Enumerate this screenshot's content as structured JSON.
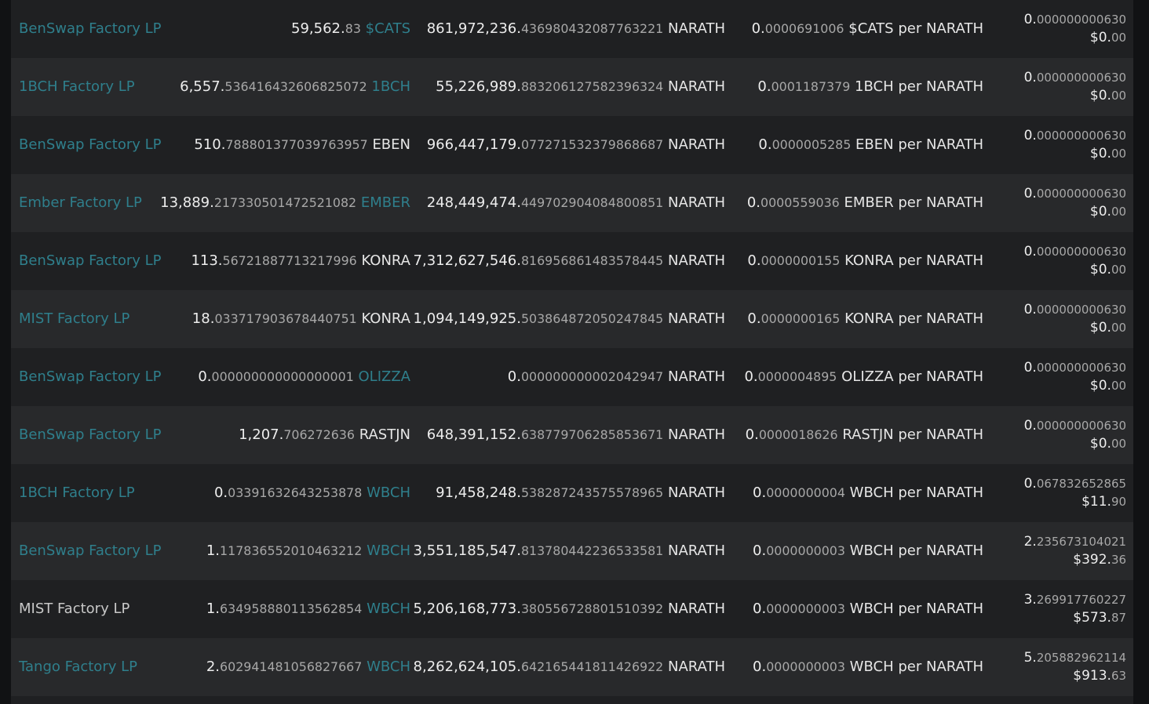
{
  "rows": [
    {
      "name": "BenSwap Factory LP",
      "name_link": true,
      "a_int": "59,562.",
      "a_frac": "83",
      "a_sym": "$CATS",
      "a_link": true,
      "b_int": "861,972,236.",
      "b_frac": "436980432087763221",
      "b_sym": "NARATH",
      "r_int": "0.",
      "r_frac": "0000691006",
      "r_sym": "$CATS",
      "r_per": "per",
      "r_of": "NARATH",
      "v_int": "0.",
      "v_frac": "000000000630",
      "d_int": "$0.",
      "d_frac": "00"
    },
    {
      "name": "1BCH Factory LP",
      "name_link": true,
      "a_int": "6,557.",
      "a_frac": "536416432606825072",
      "a_sym": "1BCH",
      "a_link": true,
      "b_int": "55,226,989.",
      "b_frac": "883206127582396324",
      "b_sym": "NARATH",
      "r_int": "0.",
      "r_frac": "0001187379",
      "r_sym": "1BCH",
      "r_per": "per",
      "r_of": "NARATH",
      "v_int": "0.",
      "v_frac": "000000000630",
      "d_int": "$0.",
      "d_frac": "00"
    },
    {
      "name": "BenSwap Factory LP",
      "name_link": true,
      "a_int": "510.",
      "a_frac": "788801377039763957",
      "a_sym": "EBEN",
      "a_link": false,
      "b_int": "966,447,179.",
      "b_frac": "077271532379868687",
      "b_sym": "NARATH",
      "r_int": "0.",
      "r_frac": "0000005285",
      "r_sym": "EBEN",
      "r_per": "per",
      "r_of": "NARATH",
      "v_int": "0.",
      "v_frac": "000000000630",
      "d_int": "$0.",
      "d_frac": "00"
    },
    {
      "name": "Ember Factory LP",
      "name_link": true,
      "a_int": "13,889.",
      "a_frac": "217330501472521082",
      "a_sym": "EMBER",
      "a_link": true,
      "b_int": "248,449,474.",
      "b_frac": "449702904084800851",
      "b_sym": "NARATH",
      "r_int": "0.",
      "r_frac": "0000559036",
      "r_sym": "EMBER",
      "r_per": "per",
      "r_of": "NARATH",
      "v_int": "0.",
      "v_frac": "000000000630",
      "d_int": "$0.",
      "d_frac": "00"
    },
    {
      "name": "BenSwap Factory LP",
      "name_link": true,
      "a_int": "113.",
      "a_frac": "56721887713217996",
      "a_sym": "KONRA",
      "a_link": false,
      "b_int": "7,312,627,546.",
      "b_frac": "816956861483578445",
      "b_sym": "NARATH",
      "r_int": "0.",
      "r_frac": "0000000155",
      "r_sym": "KONRA",
      "r_per": "per",
      "r_of": "NARATH",
      "v_int": "0.",
      "v_frac": "000000000630",
      "d_int": "$0.",
      "d_frac": "00"
    },
    {
      "name": "MIST Factory LP",
      "name_link": true,
      "a_int": "18.",
      "a_frac": "033717903678440751",
      "a_sym": "KONRA",
      "a_link": false,
      "b_int": "1,094,149,925.",
      "b_frac": "503864872050247845",
      "b_sym": "NARATH",
      "r_int": "0.",
      "r_frac": "0000000165",
      "r_sym": "KONRA",
      "r_per": "per",
      "r_of": "NARATH",
      "v_int": "0.",
      "v_frac": "000000000630",
      "d_int": "$0.",
      "d_frac": "00"
    },
    {
      "name": "BenSwap Factory LP",
      "name_link": true,
      "a_int": "0.",
      "a_frac": "000000000000000001",
      "a_sym": "OLIZZA",
      "a_link": true,
      "b_int": "0.",
      "b_frac": "000000000002042947",
      "b_sym": "NARATH",
      "r_int": "0.",
      "r_frac": "0000004895",
      "r_sym": "OLIZZA",
      "r_per": "per",
      "r_of": "NARATH",
      "v_int": "0.",
      "v_frac": "000000000630",
      "d_int": "$0.",
      "d_frac": "00"
    },
    {
      "name": "BenSwap Factory LP",
      "name_link": true,
      "a_int": "1,207.",
      "a_frac": "706272636",
      "a_sym": "RASTJN",
      "a_link": false,
      "b_int": "648,391,152.",
      "b_frac": "638779706285853671",
      "b_sym": "NARATH",
      "r_int": "0.",
      "r_frac": "0000018626",
      "r_sym": "RASTJN",
      "r_per": "per",
      "r_of": "NARATH",
      "v_int": "0.",
      "v_frac": "000000000630",
      "d_int": "$0.",
      "d_frac": "00"
    },
    {
      "name": "1BCH Factory LP",
      "name_link": true,
      "a_int": "0.",
      "a_frac": "03391632643253878",
      "a_sym": "WBCH",
      "a_link": true,
      "b_int": "91,458,248.",
      "b_frac": "538287243575578965",
      "b_sym": "NARATH",
      "r_int": "0.",
      "r_frac": "0000000004",
      "r_sym": "WBCH",
      "r_per": "per",
      "r_of": "NARATH",
      "v_int": "0.",
      "v_frac": "067832652865",
      "d_int": "$11.",
      "d_frac": "90"
    },
    {
      "name": "BenSwap Factory LP",
      "name_link": true,
      "a_int": "1.",
      "a_frac": "117836552010463212",
      "a_sym": "WBCH",
      "a_link": true,
      "b_int": "3,551,185,547.",
      "b_frac": "813780442236533581",
      "b_sym": "NARATH",
      "r_int": "0.",
      "r_frac": "0000000003",
      "r_sym": "WBCH",
      "r_per": "per",
      "r_of": "NARATH",
      "v_int": "2.",
      "v_frac": "235673104021",
      "d_int": "$392.",
      "d_frac": "36"
    },
    {
      "name": "MIST Factory LP",
      "name_link": false,
      "a_int": "1.",
      "a_frac": "634958880113562854",
      "a_sym": "WBCH",
      "a_link": true,
      "b_int": "5,206,168,773.",
      "b_frac": "380556728801510392",
      "b_sym": "NARATH",
      "r_int": "0.",
      "r_frac": "0000000003",
      "r_sym": "WBCH",
      "r_per": "per",
      "r_of": "NARATH",
      "v_int": "3.",
      "v_frac": "269917760227",
      "d_int": "$573.",
      "d_frac": "87"
    },
    {
      "name": "Tango Factory LP",
      "name_link": true,
      "a_int": "2.",
      "a_frac": "602941481056827667",
      "a_sym": "WBCH",
      "a_link": true,
      "b_int": "8,262,624,105.",
      "b_frac": "642165441811426922",
      "b_sym": "NARATH",
      "r_int": "0.",
      "r_frac": "0000000003",
      "r_sym": "WBCH",
      "r_per": "per",
      "r_of": "NARATH",
      "v_int": "5.",
      "v_frac": "205882962114",
      "d_int": "$913.",
      "d_frac": "63"
    }
  ],
  "colors": {
    "background": "#111214",
    "row_odd": "#1f2022",
    "row_even": "#28292b",
    "link": "#2f7f8c",
    "text": "#e6e6e6"
  }
}
